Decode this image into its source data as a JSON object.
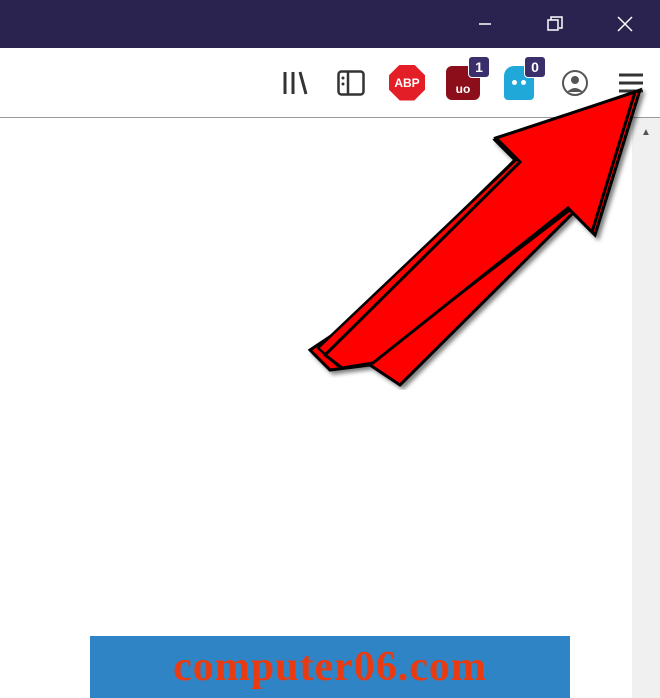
{
  "titlebar": {
    "minimize_label": "Minimize",
    "restore_label": "Restore",
    "close_label": "Close"
  },
  "toolbar": {
    "library_label": "Library",
    "sidebar_label": "Sidebar",
    "abp_text": "ABP",
    "ublock_text": "uo",
    "ublock_badge": "1",
    "ghostery_badge": "0",
    "account_label": "Account",
    "menu_label": "Menu"
  },
  "watermark": {
    "text": "computer06.com"
  },
  "colors": {
    "titlebar_bg": "#2a2350",
    "abp_red": "#e41e26",
    "ublock_dark": "#8b0e1a",
    "ghostery_blue": "#1fa8d8",
    "badge_bg": "#3a2f6b",
    "arrow_red": "#ff0000",
    "watermark_bg": "#2f84c6",
    "watermark_text": "#e93b12"
  }
}
